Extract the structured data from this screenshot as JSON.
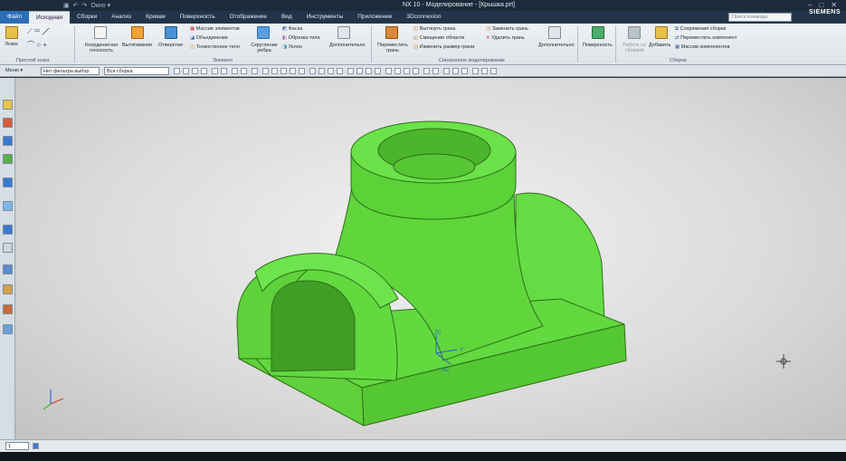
{
  "title_bar": {
    "quick_access": [
      "Окно ▾"
    ],
    "window_title": "NX 10 - Моделирование - [Крышка.prt]",
    "brand": "SIEMENS"
  },
  "tabs": [
    "Файл",
    "Исходная",
    "Сборки",
    "Анализ",
    "Кривая",
    "Поверхность",
    "Отображение",
    "Вид",
    "Инструменты",
    "Приложение",
    "3Dconnexion"
  ],
  "active_tab": "Исходная",
  "command_search": {
    "placeholder": "Поиск команды"
  },
  "ribbon": {
    "sketch": {
      "label": "Эскиз",
      "group": "Простой эскиз"
    },
    "feature": {
      "datum_plane": "Координатная плоскость",
      "extrude": "Вытягивание",
      "hole": "Отверстие",
      "pattern": "Массив элементов",
      "unite": "Объединение",
      "shell": "Тонкостенное тело",
      "edge_blend": "Скругление ребра",
      "chamfer": "Фаска",
      "trim_body": "Обрезка тела",
      "draft": "Уклон",
      "more": "Дополнительно",
      "group": "Элемент"
    },
    "sync": {
      "move_face": "Переместить грань",
      "pull_face": "Вытянуть грань",
      "offset_region": "Смещение области",
      "resize_face": "Изменить размер грани",
      "replace_face": "Заменить грань",
      "delete_face": "Удалить грань",
      "more": "Дополнительно",
      "group": "Синхронное моделирование"
    },
    "surface": {
      "label": "Поверхность"
    },
    "assembly": {
      "work_in_assembly": "Работа со сборкой",
      "add": "Добавить",
      "mates": "Сопряжения сборки",
      "move_component": "Переместить компонент",
      "pattern_component": "Массив компонентов",
      "group": "Сборки"
    }
  },
  "filter_bar": {
    "menu": "Меню ▾",
    "type_filter": "Нет фильтра выбор",
    "scope": "Вся сборка"
  },
  "viewport": {
    "part_color": "#5fd73a",
    "edge_color": "#2f6e1a",
    "triad": {
      "zc": "ZC",
      "yc": "Y",
      "xc": "XC"
    }
  },
  "status": {
    "value": "1"
  }
}
